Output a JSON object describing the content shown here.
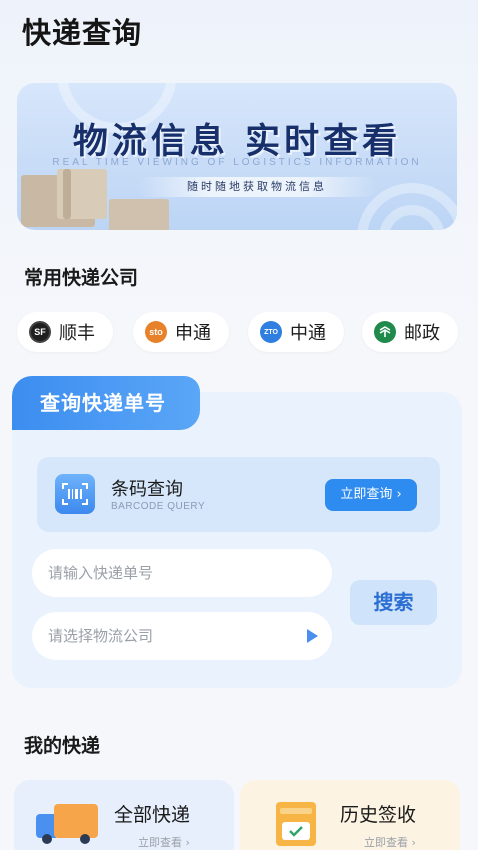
{
  "header": {
    "title": "快递查询"
  },
  "banner": {
    "title": "物流信息  实时查看",
    "subtitle": "REAL TIME VIEWING OF LOGISTICS INFORMATION",
    "tagline": "随时随地获取物流信息"
  },
  "companies": {
    "section_title": "常用快递公司",
    "items": [
      {
        "name": "顺丰",
        "logo_text": "SF",
        "logo_color": "#1f1f1f"
      },
      {
        "name": "申通",
        "logo_text": "sto",
        "logo_color": "#e8822a"
      },
      {
        "name": "中通",
        "logo_text": "ZTO",
        "logo_color": "#2f7fe0"
      },
      {
        "name": "邮政",
        "logo_text": "",
        "logo_color": "#1f8a4c"
      }
    ]
  },
  "query": {
    "tab_label": "查询快递单号",
    "barcode": {
      "title": "条码查询",
      "subtitle": "BARCODE QUERY",
      "button_label": "立即查询 ›"
    },
    "tracking_placeholder": "请输入快递单号",
    "company_placeholder": "请选择物流公司",
    "search_label": "搜索"
  },
  "my_express": {
    "section_title": "我的快递",
    "cards": [
      {
        "title": "全部快递",
        "link": "立即查看 ›",
        "icon": "truck-icon"
      },
      {
        "title": "历史签收",
        "link": "立即查看 ›",
        "icon": "box-check-icon"
      }
    ]
  },
  "colors": {
    "accent": "#2e8bf0",
    "banner_text": "#17306b",
    "card_bg": "#e9f2fd"
  }
}
